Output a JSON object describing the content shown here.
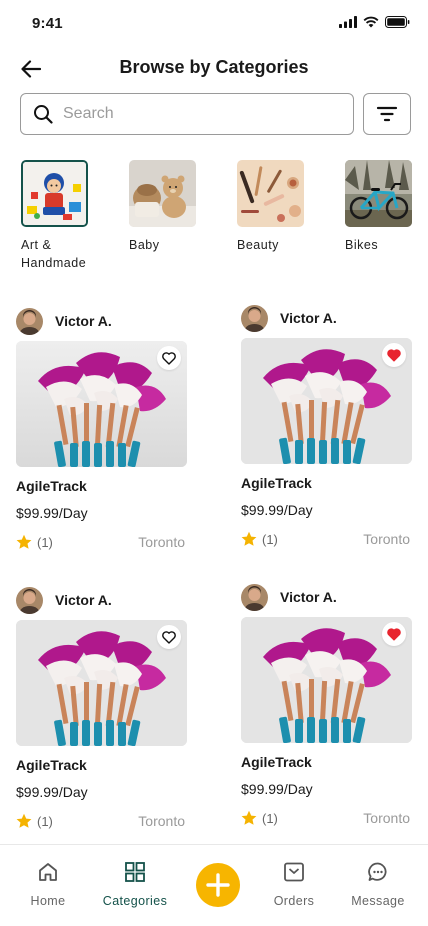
{
  "status_bar": {
    "time": "9:41"
  },
  "header": {
    "title": "Browse by Categories"
  },
  "search": {
    "placeholder": "Search"
  },
  "categories": [
    {
      "label": "Art &\nHandmade",
      "image": "toys",
      "selected": true
    },
    {
      "label": "Baby",
      "image": "teddy-bear"
    },
    {
      "label": "Beauty",
      "image": "makeup-brushes"
    },
    {
      "label": "Bikes",
      "image": "bicycle"
    }
  ],
  "products": [
    {
      "seller": "Victor A.",
      "name": "AgileTrack",
      "price": "$99.99/Day",
      "rating_count": "(1)",
      "location": "Toronto",
      "favorited": false
    },
    {
      "seller": "Victor A.",
      "name": "AgileTrack",
      "price": "$99.99/Day",
      "rating_count": "(1)",
      "location": "Toronto",
      "favorited": true
    },
    {
      "seller": "Victor A.",
      "name": "AgileTrack",
      "price": "$99.99/Day",
      "rating_count": "(1)",
      "location": "Toronto",
      "favorited": false
    },
    {
      "seller": "Victor A.",
      "name": "AgileTrack",
      "price": "$99.99/Day",
      "rating_count": "(1)",
      "location": "Toronto",
      "favorited": true
    }
  ],
  "bottom_nav": {
    "items": [
      {
        "label": "Home",
        "icon": "home-icon"
      },
      {
        "label": "Categories",
        "icon": "grid-icon",
        "active": true
      },
      {
        "label": "Orders",
        "icon": "inbox-icon"
      },
      {
        "label": "Message",
        "icon": "chat-icon"
      }
    ],
    "fab_icon": "plus-icon"
  },
  "colors": {
    "accent": "#14524a",
    "fab": "#f7b500",
    "heart": "#e8242e",
    "star": "#f5b301"
  }
}
